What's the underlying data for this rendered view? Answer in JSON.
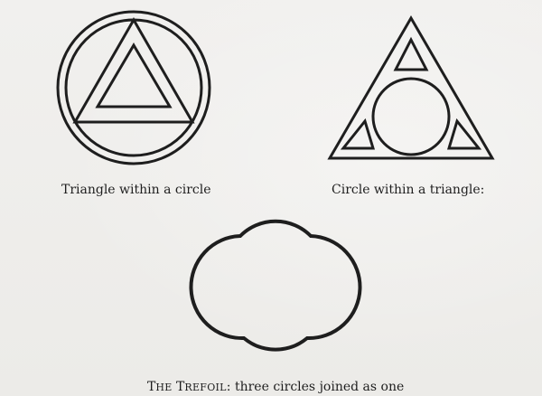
{
  "figures": [
    {
      "caption": "Triangle within a circle"
    },
    {
      "caption": "Circle within a triangle:"
    }
  ],
  "trefoil": {
    "name_initial_1": "T",
    "name_rest_1": "HE",
    "name_initial_2": "T",
    "name_rest_2": "REFOIL",
    "caption_rest": ": three circles joined as one"
  },
  "colors": {
    "ink": "#1e1e1e",
    "paper": "#efeeec"
  }
}
